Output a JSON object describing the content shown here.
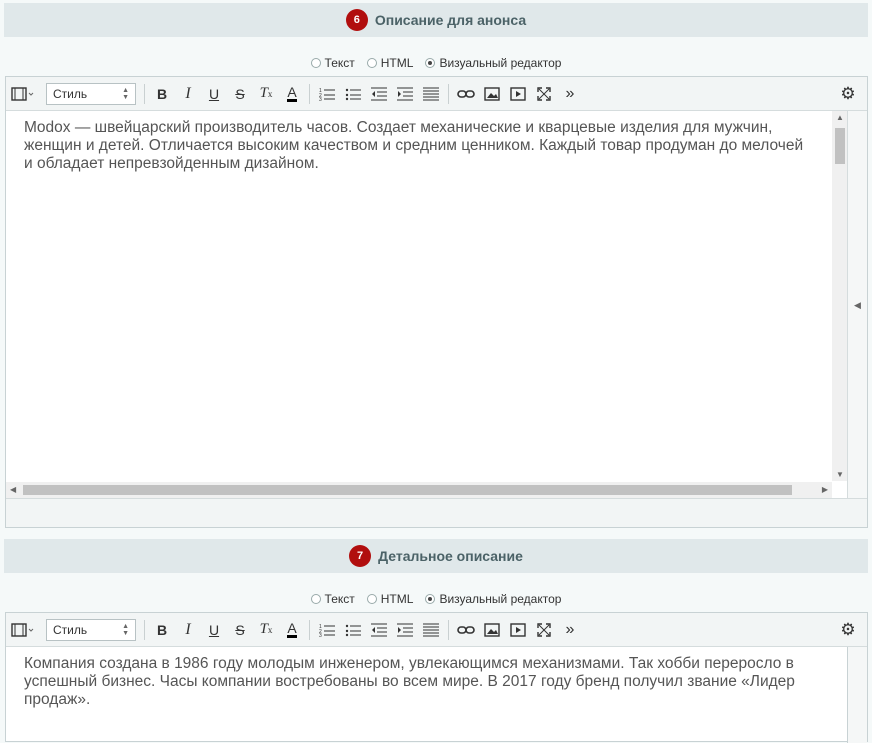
{
  "sections": [
    {
      "step": "6",
      "title": "Описание для анонса",
      "modes": {
        "text": "Текст",
        "html": "HTML",
        "visual": "Визуальный редактор"
      },
      "editor": {
        "style_label": "Стиль",
        "content": "Modox — швейцарский производитель часов. Создает механические и кварцевые изделия для мужчин, женщин и детей. Отличается высоким качеством и средним ценником. Каждый товар продуман до мелочей и обладает непревзойденным дизайном."
      }
    },
    {
      "step": "7",
      "title": "Детальное описание",
      "modes": {
        "text": "Текст",
        "html": "HTML",
        "visual": "Визуальный редактор"
      },
      "editor": {
        "style_label": "Стиль",
        "content": "Компания создана в 1986 году молодым инженером, увлекающимся механизмами. Так хобби переросло в успешный бизнес. Часы компании востребованы во всем мире. В 2017 году бренд получил звание «Лидер продаж»."
      }
    }
  ],
  "toolbar_icons": [
    "snippets-icon",
    "style-select",
    "bold-icon",
    "italic-icon",
    "underline-icon",
    "strikethrough-icon",
    "remove-format-icon",
    "text-color-icon",
    "ordered-list-icon",
    "unordered-list-icon",
    "outdent-icon",
    "indent-icon",
    "justify-icon",
    "link-icon",
    "image-icon",
    "video-icon",
    "fullscreen-icon",
    "more-icon",
    "settings-icon"
  ],
  "colors": {
    "badge": "#b10e0e",
    "header_bg": "#e0e8ea",
    "title": "#4b6267"
  }
}
